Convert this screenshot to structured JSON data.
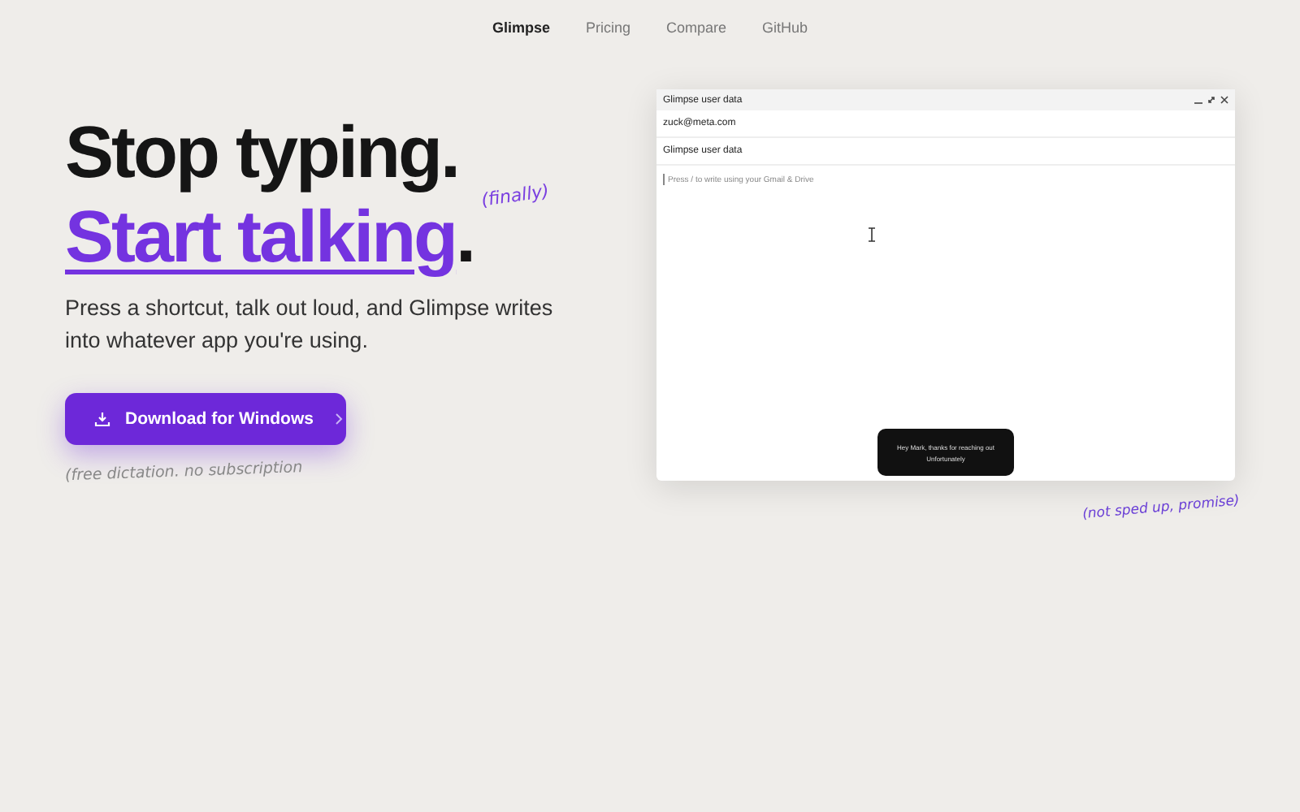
{
  "nav": [
    {
      "label": "Glimpse",
      "selected": true
    },
    {
      "label": "Pricing",
      "selected": false
    },
    {
      "label": "Compare",
      "selected": false
    },
    {
      "label": "GitHub",
      "selected": false
    }
  ],
  "hero": {
    "line_1": "Stop typing.",
    "line_2": "Start talking",
    "line_2_end": ".",
    "aside": "(finally)",
    "subtitle": "Press a shortcut, talk out loud, and Glimpse writes into whatever app you're using.",
    "button": "Download for Windows",
    "note": "(free dictation. no subscription"
  },
  "demo": {
    "title": "Glimpse user data",
    "to": "zuck@meta.com",
    "subject": "Glimpse user data",
    "body_placeholder": "Press  /  to write using your Gmail & Drive",
    "toast": [
      "Hey Mark, thanks for reaching out",
      "Unfortunately"
    ],
    "caption": "(not sped up, promise)"
  }
}
